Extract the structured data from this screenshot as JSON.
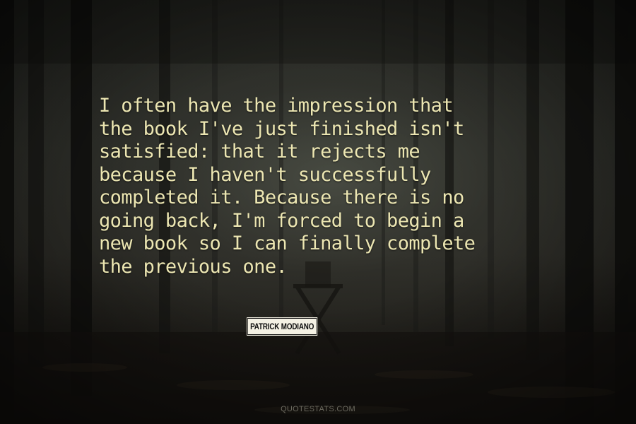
{
  "quote": {
    "lines": [
      "I often have the impression that",
      "the book I've just finished isn't",
      "satisfied: that it rejects me",
      "because I haven't successfully",
      "completed it. Because there is no",
      "going back, I'm forced to begin a",
      "new book so I can finally complete",
      "the previous one."
    ]
  },
  "author": "PATRICK MODIANO",
  "watermark": "QUOTESTATS.COM",
  "colors": {
    "quote_text": "#ece6b2",
    "background": "#2a2924"
  }
}
